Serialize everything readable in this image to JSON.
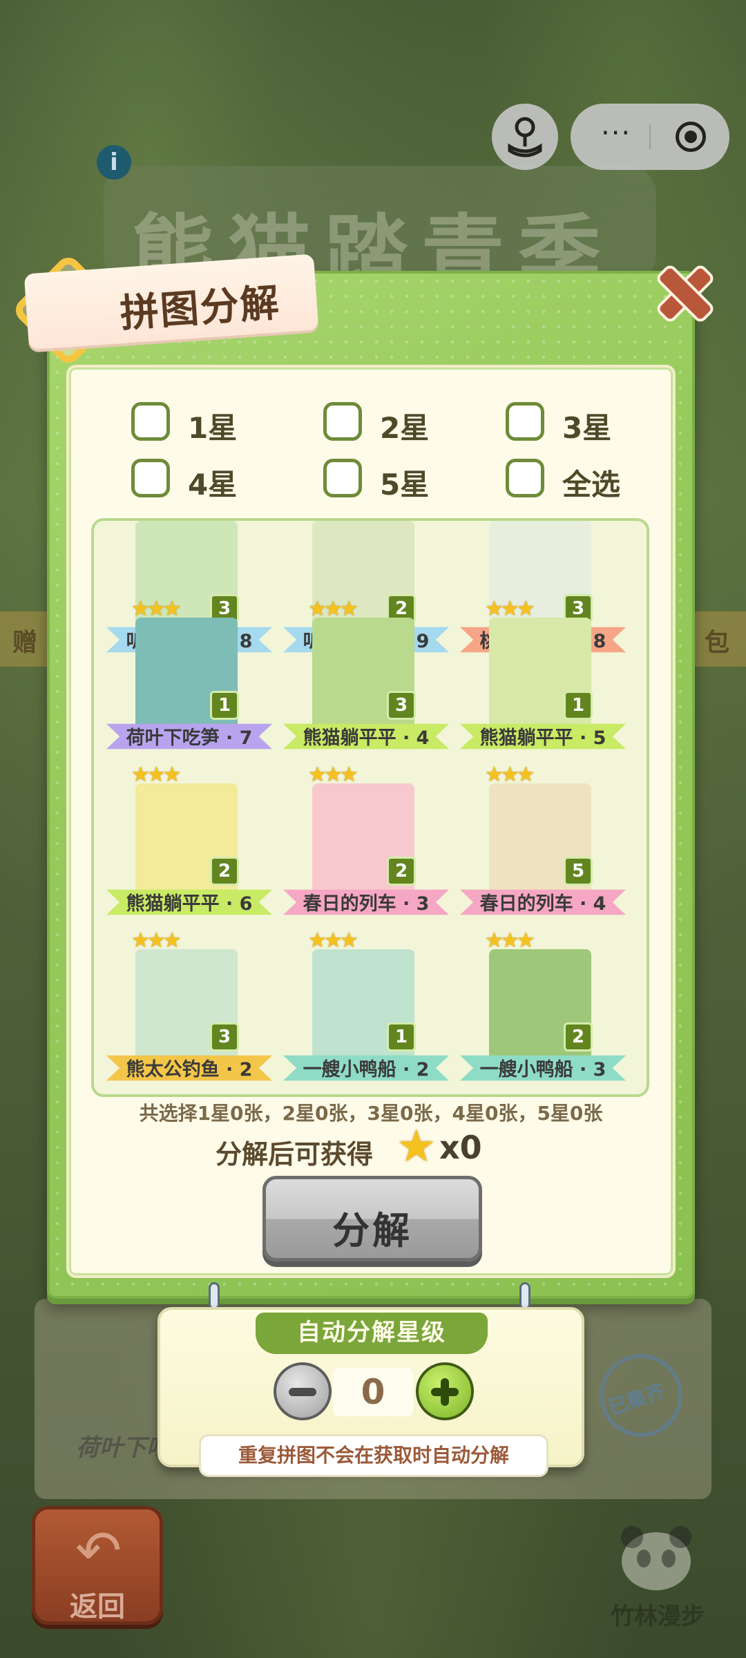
{
  "background": {
    "title": "熊猫踏青季",
    "info_icon": "i",
    "left_strip": "赠",
    "right_strip": "包",
    "lower_card_label": "荷叶下吃",
    "stamp": "已集齐",
    "bottom_right_label": "竹林漫步"
  },
  "capsule": {
    "more": "···"
  },
  "panel": {
    "title": "拼图分解",
    "filters": [
      "1星",
      "2星",
      "3星",
      "4星",
      "5星",
      "全选"
    ],
    "cards": [
      {
        "label": "听风又般雨 · 8",
        "count": "3",
        "stars": "",
        "ribbon": "#a5d9ee",
        "art": "#cfe6b8"
      },
      {
        "label": "听风又般雨 · 9",
        "count": "2",
        "stars": "",
        "ribbon": "#a5d9ee",
        "art": "#dde8c2"
      },
      {
        "label": "桃树上偷懒 · 8",
        "count": "3",
        "stars": "",
        "ribbon": "#f6a587",
        "art": "#e8eedd"
      },
      {
        "label": "荷叶下吃笋 · 7",
        "count": "1",
        "stars": "★★★",
        "ribbon": "#b8a4ee",
        "art": "#7ebcb6"
      },
      {
        "label": "熊猫躺平平 · 4",
        "count": "3",
        "stars": "★★★",
        "ribbon": "#c9ea64",
        "art": "#b9d98c"
      },
      {
        "label": "熊猫躺平平 · 5",
        "count": "1",
        "stars": "★★★",
        "ribbon": "#c9ea64",
        "art": "#d7e8a8"
      },
      {
        "label": "熊猫躺平平 · 6",
        "count": "2",
        "stars": "★★★",
        "ribbon": "#c9ea64",
        "art": "#f3ea9a"
      },
      {
        "label": "春日的列车 · 3",
        "count": "2",
        "stars": "★★★",
        "ribbon": "#f6a7c4",
        "art": "#f7c9cf"
      },
      {
        "label": "春日的列车 · 4",
        "count": "5",
        "stars": "★★★",
        "ribbon": "#f6a7c4",
        "art": "#efe2c0"
      },
      {
        "label": "熊太公钓鱼 · 2",
        "count": "3",
        "stars": "★★★",
        "ribbon": "#f3c64a",
        "art": "#cfe6cf"
      },
      {
        "label": "一艘小鸭船 · 2",
        "count": "1",
        "stars": "★★★",
        "ribbon": "#8fdcc6",
        "art": "#bfe3cf"
      },
      {
        "label": "一艘小鸭船 · 3",
        "count": "2",
        "stars": "★★★",
        "ribbon": "#8fdcc6",
        "art": "#9fc77a"
      }
    ],
    "summary": "共选择1星0张，2星0张，3星0张，4星0张，5星0张",
    "gain_label": "分解后可获得",
    "gain_value": "x0",
    "decompose_button": "分解"
  },
  "auto": {
    "title": "自动分解星级",
    "value": "0",
    "note": "重复拼图不会在获取时自动分解"
  },
  "back": {
    "label": "返回"
  },
  "colors": {
    "panel_green": "#96c95a",
    "accent_gold": "#f5c21d",
    "text_brown": "#5b3a22"
  }
}
